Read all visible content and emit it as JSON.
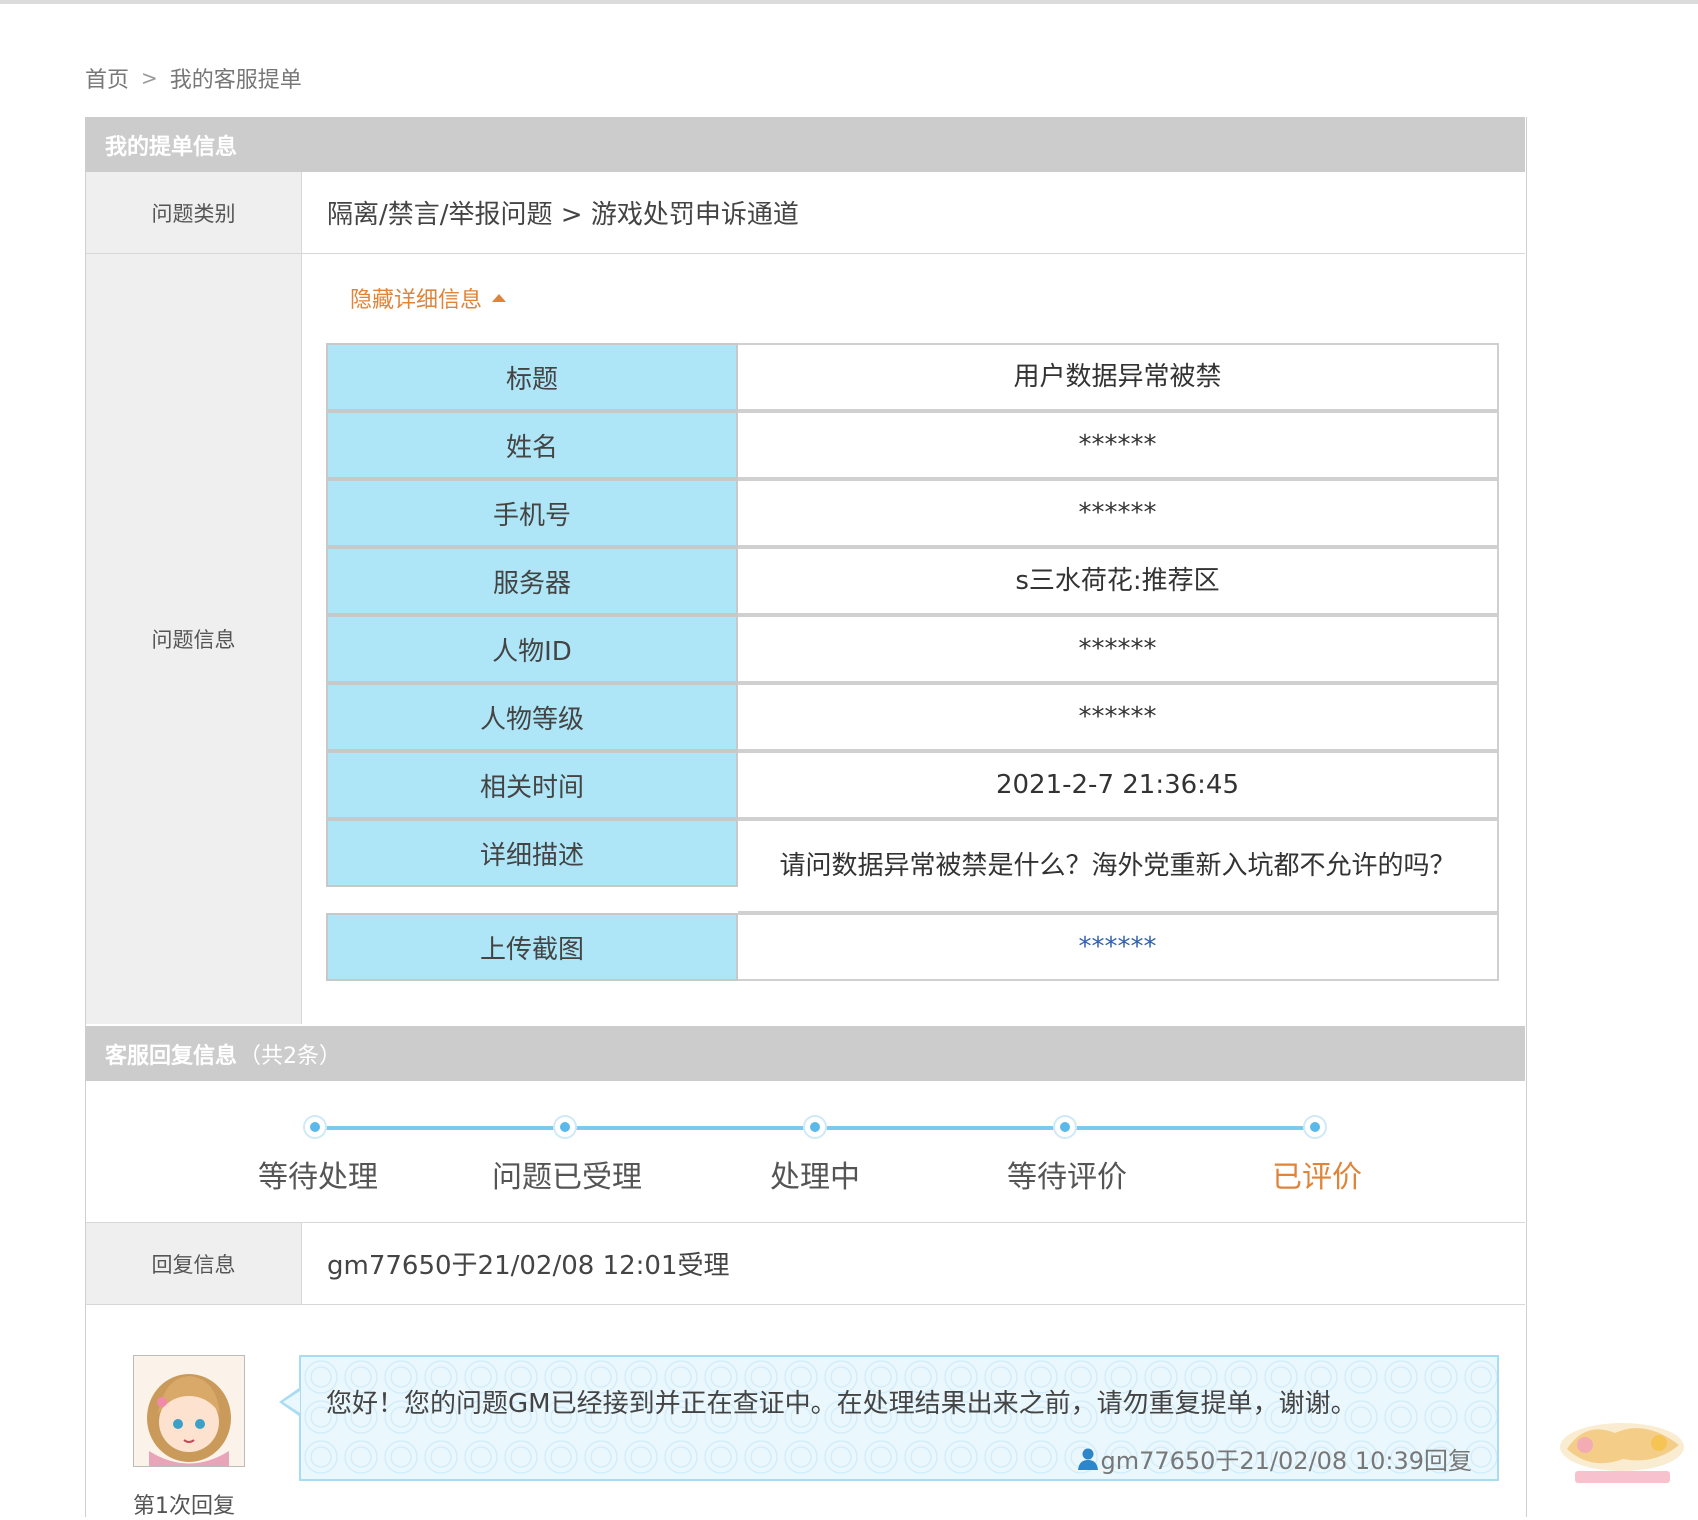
{
  "breadcrumb": {
    "home": "首页",
    "separator": ">",
    "current": "我的客服提单"
  },
  "ticket": {
    "header": "我的提单信息",
    "category_label": "问题类别",
    "category_value": "隔离/禁言/举报问题 > 游戏处罚申诉通道",
    "info_label": "问题信息",
    "toggle_label": "隐藏详细信息",
    "fields": [
      {
        "key": "标题",
        "value": "用户数据异常被禁"
      },
      {
        "key": "姓名",
        "value": "******"
      },
      {
        "key": "手机号",
        "value": "******"
      },
      {
        "key": "服务器",
        "value": "s三水荷花:推荐区"
      },
      {
        "key": "人物ID",
        "value": "******"
      },
      {
        "key": "人物等级",
        "value": "******"
      },
      {
        "key": "相关时间",
        "value": "2021-2-7 21:36:45"
      },
      {
        "key": "详细描述",
        "value": "请问数据异常被禁是什么？海外党重新入坑都不允许的吗？"
      },
      {
        "key": "上传截图",
        "value": "******"
      }
    ]
  },
  "reply": {
    "header": "客服回复信息",
    "count_text": "（共2条）",
    "steps": [
      "等待处理",
      "问题已受理",
      "处理中",
      "等待评价",
      "已评价"
    ],
    "active_step": 4,
    "reply_label": "回复信息",
    "accepted_text": "gm77650于21/02/08 12:01受理",
    "first_reply_caption": "第1次回复",
    "message": "您好！您的问题GM已经接到并正在查证中。在处理结果出来之前，请勿重复提单，谢谢。",
    "meta": "gm77650于21/02/08 10:39回复"
  },
  "colors": {
    "accent": "#e0843a",
    "key_cell": "#aee6f8",
    "section_head": "#cccccc",
    "progress": "#7cc9ee"
  }
}
